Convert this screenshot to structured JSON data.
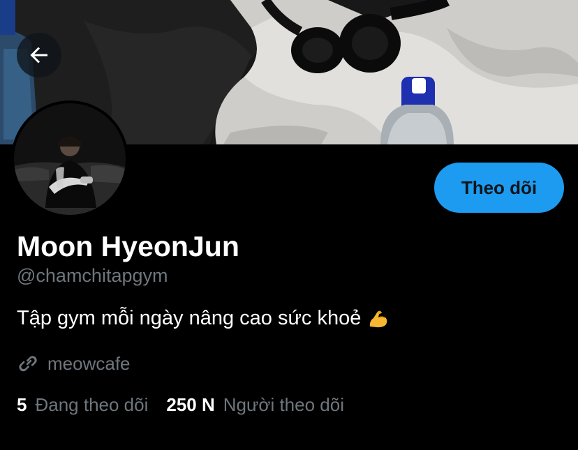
{
  "profile": {
    "name": "Moon HyeonJun",
    "handle": "@chamchitapgym",
    "bio": "Tập gym mỗi ngày nâng cao sức khoẻ",
    "bio_emoji": "flexed-biceps-icon",
    "website": "meowcafe",
    "following_count": "5",
    "following_label": "Đang theo dõi",
    "followers_count": "250 N",
    "followers_label": "Người theo dõi"
  },
  "actions": {
    "follow_label": "Theo dõi",
    "back_icon": "arrow-left-icon"
  },
  "colors": {
    "background": "#000000",
    "accent": "#1d9bf0",
    "primary_text": "#ffffff",
    "secondary_text": "#6e767d"
  }
}
